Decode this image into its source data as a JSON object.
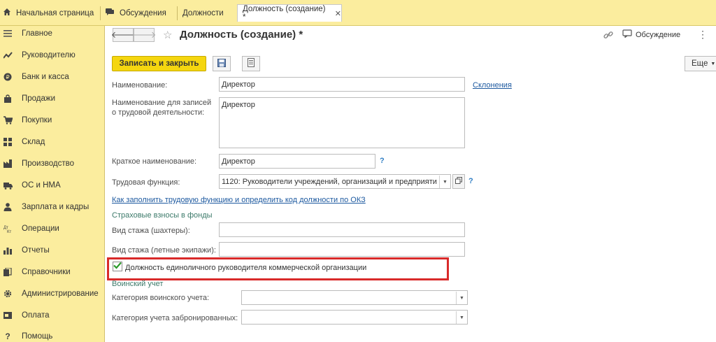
{
  "tabs": [
    {
      "label": "Начальная страница",
      "icon": "home-icon"
    },
    {
      "label": "Обсуждения",
      "icon": "discussion-icon"
    },
    {
      "label": "Должности"
    },
    {
      "label": "Должность (создание) *",
      "active": true,
      "close": "✕"
    }
  ],
  "sidebar": {
    "items": [
      {
        "label": "Главное",
        "icon": "menu-icon"
      },
      {
        "label": "Руководителю",
        "icon": "trend-icon"
      },
      {
        "label": "Банк и касса",
        "icon": "coin-icon"
      },
      {
        "label": "Продажи",
        "icon": "bag-icon"
      },
      {
        "label": "Покупки",
        "icon": "cart-icon"
      },
      {
        "label": "Склад",
        "icon": "warehouse-icon"
      },
      {
        "label": "Производство",
        "icon": "factory-icon"
      },
      {
        "label": "ОС и НМА",
        "icon": "truck-icon"
      },
      {
        "label": "Зарплата и кадры",
        "icon": "person-icon"
      },
      {
        "label": "Операции",
        "icon": "operations-icon"
      },
      {
        "label": "Отчеты",
        "icon": "bar-chart-icon"
      },
      {
        "label": "Справочники",
        "icon": "books-icon"
      },
      {
        "label": "Администрирование",
        "icon": "gear-icon"
      },
      {
        "label": "Оплата",
        "icon": "payment-icon"
      },
      {
        "label": "Помощь",
        "icon": "help-icon"
      }
    ]
  },
  "header": {
    "title": "Должность (создание) *",
    "discussion_label": "Обсуждение",
    "more_dots": "⋮"
  },
  "toolbar": {
    "save_close_label": "Записать и закрыть",
    "more_label": "Еще"
  },
  "form": {
    "name_label": "Наименование:",
    "name_value": "Директор",
    "declensions_link": "Склонения",
    "work_name_label_1": "Наименование для записей",
    "work_name_label_2": "о трудовой деятельности:",
    "work_name_value": "Директор",
    "short_name_label": "Краткое наименование:",
    "short_name_value": "Директор",
    "labor_function_label": "Трудовая функция:",
    "labor_function_value": "1120: Руководители учреждений, организаций и предприяти",
    "help_mark": "?",
    "okz_link": "Как заполнить трудовую функцию и определить код должности по ОКЗ",
    "insurance_section": "Страховые взносы в фонды",
    "miner_label": "Вид стажа (шахтеры):",
    "miner_value": "",
    "flight_label": "Вид стажа (летные экипажи):",
    "flight_value": "",
    "sole_head_label": "Должность единоличного руководителя коммерческой организации",
    "sole_head_checked": true,
    "military_section": "Воинский учет",
    "military_category_label": "Категория воинского учета:",
    "military_category_value": "",
    "reserved_category_label": "Категория учета забронированных:",
    "reserved_category_value": ""
  },
  "colors": {
    "sidebar_bg": "#fbed9e",
    "primary_button": "#f5d60f",
    "highlight": "#d92a2a",
    "link": "#1e5aa0"
  }
}
